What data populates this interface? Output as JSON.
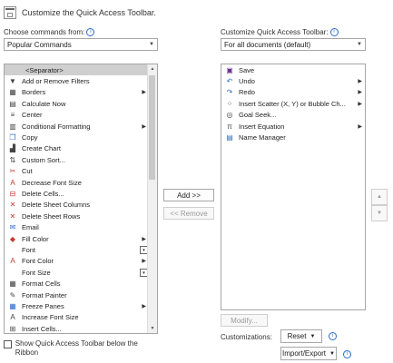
{
  "header": {
    "title": "Customize the Quick Access Toolbar."
  },
  "left": {
    "choose_label": "Choose commands from:",
    "choose_value": "Popular Commands",
    "commands": [
      {
        "label": "<Separator>",
        "icon": "separator-icon",
        "glyph": "",
        "selected": true,
        "sub": ""
      },
      {
        "label": "Add or Remove Filters",
        "icon": "filter-icon",
        "glyph": "▼",
        "sub": ""
      },
      {
        "label": "Borders",
        "icon": "borders-icon",
        "glyph": "▦",
        "sub": "arrow"
      },
      {
        "label": "Calculate Now",
        "icon": "calculator-icon",
        "glyph": "▤",
        "sub": ""
      },
      {
        "label": "Center",
        "icon": "center-align-icon",
        "glyph": "≡",
        "sub": ""
      },
      {
        "label": "Conditional Formatting",
        "icon": "conditional-formatting-icon",
        "glyph": "▥",
        "sub": "arrow"
      },
      {
        "label": "Copy",
        "icon": "copy-icon",
        "glyph": "❐",
        "sub": ""
      },
      {
        "label": "Create Chart",
        "icon": "chart-icon",
        "glyph": "▟",
        "sub": ""
      },
      {
        "label": "Custom Sort...",
        "icon": "sort-icon",
        "glyph": "⇅",
        "sub": ""
      },
      {
        "label": "Cut",
        "icon": "cut-icon",
        "glyph": "✂",
        "sub": ""
      },
      {
        "label": "Decrease Font Size",
        "icon": "decrease-font-icon",
        "glyph": "A",
        "sub": ""
      },
      {
        "label": "Delete Cells...",
        "icon": "delete-cells-icon",
        "glyph": "⊟",
        "sub": ""
      },
      {
        "label": "Delete Sheet Columns",
        "icon": "delete-columns-icon",
        "glyph": "✕",
        "sub": ""
      },
      {
        "label": "Delete Sheet Rows",
        "icon": "delete-rows-icon",
        "glyph": "✕",
        "sub": ""
      },
      {
        "label": "Email",
        "icon": "email-icon",
        "glyph": "✉",
        "sub": ""
      },
      {
        "label": "Fill Color",
        "icon": "fill-color-icon",
        "glyph": "◆",
        "sub": "arrow"
      },
      {
        "label": "Font",
        "icon": "font-icon",
        "glyph": "",
        "sub": "box"
      },
      {
        "label": "Font Color",
        "icon": "font-color-icon",
        "glyph": "A",
        "sub": "arrow"
      },
      {
        "label": "Font Size",
        "icon": "font-size-icon",
        "glyph": "",
        "sub": "box"
      },
      {
        "label": "Format Cells",
        "icon": "format-cells-icon",
        "glyph": "▦",
        "sub": ""
      },
      {
        "label": "Format Painter",
        "icon": "format-painter-icon",
        "glyph": "✎",
        "sub": ""
      },
      {
        "label": "Freeze Panes",
        "icon": "freeze-panes-icon",
        "glyph": "▦",
        "sub": "arrow"
      },
      {
        "label": "Increase Font Size",
        "icon": "increase-font-icon",
        "glyph": "A",
        "sub": ""
      },
      {
        "label": "Insert Cells...",
        "icon": "insert-cells-icon",
        "glyph": "⊞",
        "sub": ""
      }
    ],
    "show_below_label": "Show Quick Access Toolbar below the Ribbon"
  },
  "middle": {
    "add_label": "Add >>",
    "remove_label": "<< Remove"
  },
  "right": {
    "customize_label": "Customize Quick Access Toolbar:",
    "customize_value": "For all documents (default)",
    "items": [
      {
        "label": "Save",
        "icon": "save-icon",
        "glyph": "▣",
        "sub": ""
      },
      {
        "label": "Undo",
        "icon": "undo-icon",
        "glyph": "↶",
        "sub": "arrow"
      },
      {
        "label": "Redo",
        "icon": "redo-icon",
        "glyph": "↷",
        "sub": "arrow"
      },
      {
        "label": "Insert Scatter (X, Y) or Bubble Ch...",
        "icon": "scatter-chart-icon",
        "glyph": "⁘",
        "sub": "arrow"
      },
      {
        "label": "Goal Seek...",
        "icon": "goal-seek-icon",
        "glyph": "◎",
        "sub": ""
      },
      {
        "label": "Insert Equation",
        "icon": "equation-icon",
        "glyph": "π",
        "sub": "arrow"
      },
      {
        "label": "Name Manager",
        "icon": "name-manager-icon",
        "glyph": "▤",
        "sub": ""
      }
    ],
    "modify_label": "Modify...",
    "customizations_label": "Customizations:",
    "reset_label": "Reset",
    "import_export_label": "Import/Export"
  }
}
